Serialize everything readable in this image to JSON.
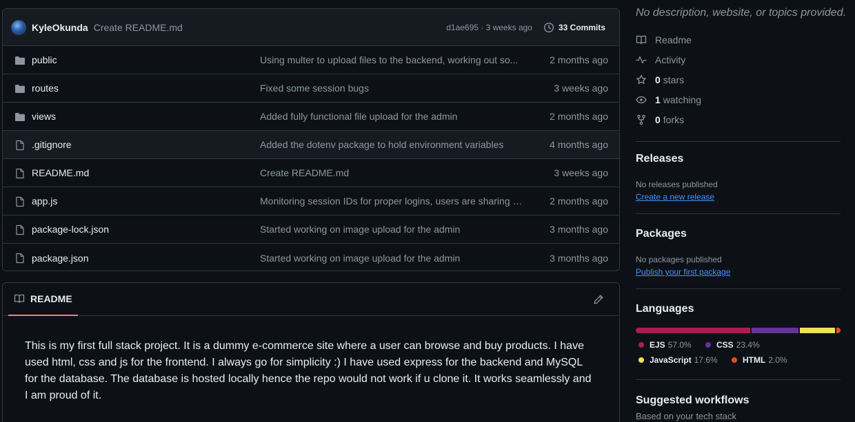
{
  "commit_bar": {
    "author": "KyleOkunda",
    "message": "Create README.md",
    "sha_time": "d1ae695 · 3 weeks ago",
    "commits_label": "33 Commits"
  },
  "files": [
    {
      "name": "public",
      "type": "folder",
      "message": "Using multer to upload files to the backend, working out so...",
      "time": "2 months ago"
    },
    {
      "name": "routes",
      "type": "folder",
      "message": "Fixed some session bugs",
      "time": "3 weeks ago"
    },
    {
      "name": "views",
      "type": "folder",
      "message": "Added fully functional file upload for the admin",
      "time": "2 months ago"
    },
    {
      "name": ".gitignore",
      "type": "file",
      "message": "Added the dotenv package to hold environment variables",
      "time": "4 months ago"
    },
    {
      "name": "README.md",
      "type": "file",
      "message": "Create README.md",
      "time": "3 weeks ago"
    },
    {
      "name": "app.js",
      "type": "file",
      "message": "Monitoring session IDs for proper logins, users are sharing s...",
      "time": "2 months ago"
    },
    {
      "name": "package-lock.json",
      "type": "file",
      "message": "Started working on image upload for the admin",
      "time": "3 months ago"
    },
    {
      "name": "package.json",
      "type": "file",
      "message": "Started working on image upload for the admin",
      "time": "3 months ago"
    }
  ],
  "readme": {
    "tab_label": "README",
    "body": "This is my first full stack project. It is a dummy e-commerce site where a user can browse and buy products. I have used html, css and js for the frontend. I always go for simplicity :) I have used express for the backend and MySQL for the database. The database is hosted locally hence the repo would not work if u clone it. It works seamlessly and I am proud of it."
  },
  "about": {
    "description": "No description, website, or topics provided.",
    "readme_label": "Readme",
    "activity_label": "Activity",
    "stars_count": "0",
    "stars_label": "stars",
    "watching_count": "1",
    "watching_label": "watching",
    "forks_count": "0",
    "forks_label": "forks"
  },
  "releases": {
    "title": "Releases",
    "empty_text": "No releases published",
    "link": "Create a new release"
  },
  "packages": {
    "title": "Packages",
    "empty_text": "No packages published",
    "link": "Publish your first package"
  },
  "languages": {
    "title": "Languages",
    "items": [
      {
        "name": "EJS",
        "percent": "57.0%",
        "value": 57.0,
        "color": "#a91e50"
      },
      {
        "name": "CSS",
        "percent": "23.4%",
        "value": 23.4,
        "color": "#663399"
      },
      {
        "name": "JavaScript",
        "percent": "17.6%",
        "value": 17.6,
        "color": "#f1e05a"
      },
      {
        "name": "HTML",
        "percent": "2.0%",
        "value": 2.0,
        "color": "#e34c26"
      }
    ]
  },
  "workflows": {
    "title": "Suggested workflows",
    "subtitle": "Based on your tech stack"
  }
}
